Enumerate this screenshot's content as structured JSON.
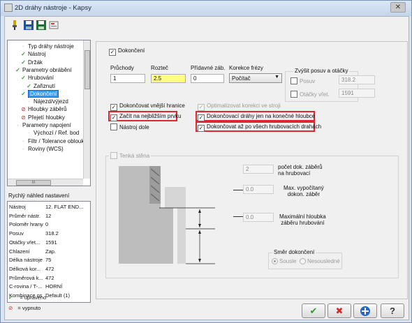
{
  "window": {
    "title": "2D dráhy nástroje - Kapsy",
    "close_glyph": "✕"
  },
  "toolbar": [
    "tool-icon",
    "save-icon",
    "save-all-icon",
    "options-icon"
  ],
  "tree": [
    {
      "label": "Typ dráhy nástroje",
      "state": "none",
      "indent": 2
    },
    {
      "label": "Nástroj",
      "state": "check",
      "indent": 2
    },
    {
      "label": "Držák",
      "state": "check",
      "indent": 2
    },
    {
      "label": "Parametry obrábění",
      "state": "check",
      "indent": 1
    },
    {
      "label": "Hrubování",
      "state": "check",
      "indent": 2
    },
    {
      "label": "Zařiznutí",
      "state": "check",
      "indent": 3
    },
    {
      "label": "Dokončení",
      "state": "check",
      "indent": 2,
      "selected": true
    },
    {
      "label": "Nájezd/výjezd",
      "state": "none",
      "indent": 3
    },
    {
      "label": "Hloubky záběrů",
      "state": "off",
      "indent": 2
    },
    {
      "label": "Přejetí hloubky",
      "state": "off",
      "indent": 2
    },
    {
      "label": "Parametry napojení",
      "state": "none",
      "indent": 1
    },
    {
      "label": "Výchozí / Ref. bod",
      "state": "none",
      "indent": 3
    },
    {
      "label": "Filtr / Tolerance obloukú",
      "state": "none",
      "indent": 2
    },
    {
      "label": "Roviny (WCS)",
      "state": "none",
      "indent": 2
    }
  ],
  "tree_hscroll_glyph": "III",
  "quick_settings": {
    "title": "Rychlý náhled nastavení",
    "rows": [
      {
        "k": "Nástroj",
        "v": "12. FLAT END..."
      },
      {
        "k": "Průměr nástr.",
        "v": "12"
      },
      {
        "k": "Poloměr hrany",
        "v": "0"
      },
      {
        "k": "Posuv",
        "v": "318.2"
      },
      {
        "k": "Otáčky vřet...",
        "v": "1591"
      },
      {
        "k": "Chlazení",
        "v": "Zap."
      },
      {
        "k": "Délka nástroje",
        "v": "75"
      },
      {
        "k": "Délková kor...",
        "v": "472"
      },
      {
        "k": "Průměrová k...",
        "v": "472"
      },
      {
        "k": "C-rovina / T-...",
        "v": "HORNÍ"
      },
      {
        "k": "Kombinace os",
        "v": "Default (1)"
      }
    ]
  },
  "legend": {
    "edited": "= upraveno",
    "disabled": "= vypnuto"
  },
  "finishing": {
    "enable_label": "Dokončení",
    "passes_label": "Průchody",
    "passes_value": "1",
    "step_label": "Rozteč",
    "step_value": "2.5",
    "extra_label": "Přídavné záb.",
    "extra_value": "0",
    "comp_label": "Korekce frézy",
    "comp_value": "Počítač",
    "finish_outer": "Dokončovat vnější hranice",
    "start_nearest": "Začít na nejbližším prvku",
    "tool_down": "Nástroj dole",
    "optimize_comp": "Optimalizovat korekci ve stroji",
    "finish_final_depth": "Dokončovací dráhy jen na konečné hloubce",
    "finish_after_roughing": "Dokončovat až po všech hrubovacích drahách"
  },
  "feed_override": {
    "title": "Zvýšit posuv a otáčky",
    "feed_label": "Posuv",
    "feed_value": "318.2",
    "spindle_label": "Otáčky vřet.",
    "spindle_value": "1591"
  },
  "thin_wall": {
    "label": "Tenká stěna",
    "passes_value": "2",
    "passes_label_1": "počet dok. záběrů",
    "passes_label_2": "na hrubovací",
    "max_cut_value": "0.0",
    "max_cut_label_1": "Max. vypočítaný",
    "max_cut_label_2": "dokon. záběr",
    "max_depth_value": "0.0",
    "max_depth_label_1": "Maximální hloubka",
    "max_depth_label_2": "záběru hrubování"
  },
  "direction": {
    "title": "Směr dokončení",
    "climb": "Sousle",
    "conventional": "Nesousledné"
  },
  "buttons": {
    "ok": "✔",
    "cancel": "✖",
    "help": "?"
  },
  "colors": {
    "red_highlight": "#e0262e",
    "selected": "#3399ff",
    "yellow_field": "#ffff80"
  }
}
